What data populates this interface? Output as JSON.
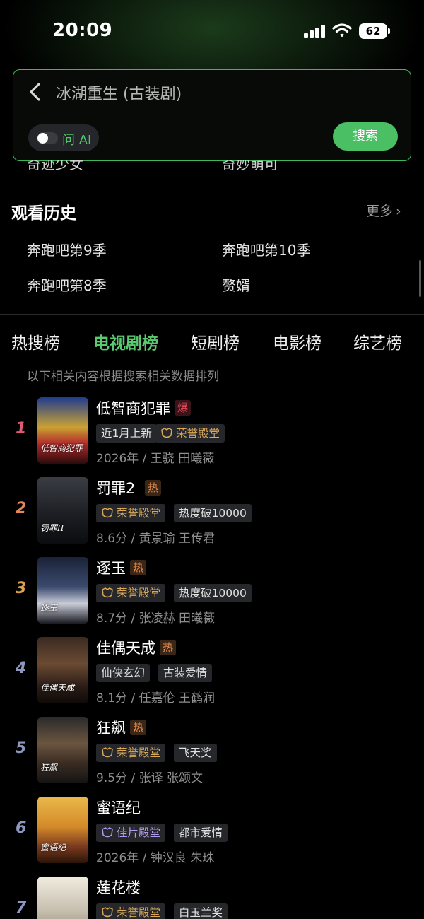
{
  "status_bar": {
    "time": "20:09",
    "battery": "62"
  },
  "search": {
    "query": "冰湖重生 (古装剧)",
    "ai_label": "问 AI",
    "search_button": "搜索"
  },
  "clipped_suggestions": [
    "奇迹少女",
    "奇妙萌可"
  ],
  "history": {
    "title": "观看历史",
    "more": "更多",
    "items": [
      "奔跑吧第9季",
      "奔跑吧第10季",
      "奔跑吧第8季",
      "赘婿"
    ]
  },
  "tabs": [
    "热搜榜",
    "电视剧榜",
    "短剧榜",
    "电影榜",
    "综艺榜"
  ],
  "active_tab": "电视剧榜",
  "subtitle": "以下相关内容根据搜索相关数据排列",
  "colors": {
    "accent": "#4bbf63",
    "rank1": "#e05a78",
    "rank2": "#e48955",
    "rank3": "#e0a04e",
    "rank_other": "#8d97c0"
  },
  "rankings": [
    {
      "rank": "1",
      "title": "低智商犯罪",
      "badge": "爆",
      "tags": [
        "近1月上新",
        "荣誉殿堂"
      ],
      "meta": "2026年 / 王骁 田曦薇",
      "poster_text": "低智商犯罪"
    },
    {
      "rank": "2",
      "title": "罚罪2",
      "badge": "热",
      "tags": [
        "荣誉殿堂",
        "热度破10000"
      ],
      "meta": "8.6分 / 黄景瑜 王传君",
      "poster_text": "罚罪II"
    },
    {
      "rank": "3",
      "title": "逐玉",
      "badge": "热",
      "tags": [
        "荣誉殿堂",
        "热度破10000"
      ],
      "meta": "8.7分 / 张凌赫 田曦薇",
      "poster_text": "逐玉"
    },
    {
      "rank": "4",
      "title": "佳偶天成",
      "badge": "热",
      "tags": [
        "仙侠玄幻",
        "古装爱情"
      ],
      "meta": "8.1分 / 任嘉伦 王鹤润",
      "poster_text": "佳偶天成"
    },
    {
      "rank": "5",
      "title": "狂飙",
      "badge": "热",
      "tags": [
        "荣誉殿堂",
        "飞天奖"
      ],
      "meta": "9.5分 / 张译 张颂文",
      "poster_text": "狂飙"
    },
    {
      "rank": "6",
      "title": "蜜语纪",
      "badge": "",
      "tags": [
        "佳片殿堂",
        "都市爱情"
      ],
      "meta": "2026年 / 钟汉良 朱珠",
      "poster_text": "蜜语纪"
    },
    {
      "rank": "7",
      "title": "莲花楼",
      "badge": "",
      "tags": [
        "荣誉殿堂",
        "白玉兰奖"
      ],
      "meta": "",
      "poster_text": ""
    }
  ]
}
